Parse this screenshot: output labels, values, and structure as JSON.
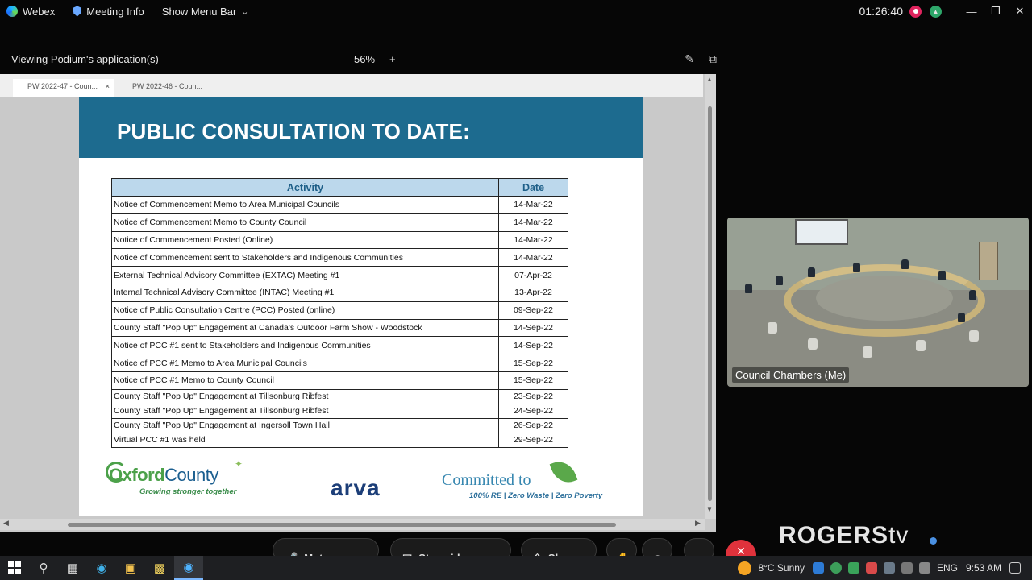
{
  "titlebar": {
    "app_name": "Webex",
    "meeting_info": "Meeting Info",
    "show_menu_bar": "Show Menu Bar",
    "timer": "01:26:40"
  },
  "share": {
    "viewing_label": "Viewing Podium's application(s)",
    "zoom_level": "56%"
  },
  "browser": {
    "tabs": [
      "PW 2022-47 - Coun...",
      "PW 2022-46 - Coun..."
    ]
  },
  "slide": {
    "title": "PUBLIC CONSULTATION TO DATE:",
    "table": {
      "headers": [
        "Activity",
        "Date"
      ],
      "rows": [
        [
          "Notice of Commencement Memo to Area Municipal Councils",
          "14-Mar-22"
        ],
        [
          "Notice of Commencement Memo to County Council",
          "14-Mar-22"
        ],
        [
          "Notice of Commencement Posted (Online)",
          "14-Mar-22"
        ],
        [
          "Notice of Commencement sent to Stakeholders and Indigenous Communities",
          "14-Mar-22"
        ],
        [
          "External Technical Advisory Committee (EXTAC) Meeting #1",
          "07-Apr-22"
        ],
        [
          "Internal Technical Advisory Committee (INTAC) Meeting #1",
          "13-Apr-22"
        ],
        [
          "Notice of Public Consultation Centre (PCC) Posted (online)",
          "09-Sep-22"
        ],
        [
          "County Staff \"Pop Up\" Engagement at Canada's Outdoor Farm Show - Woodstock",
          "14-Sep-22"
        ],
        [
          "Notice of PCC #1 sent to Stakeholders and Indigenous Communities",
          "14-Sep-22"
        ],
        [
          "Notice of PCC #1 Memo to Area Municipal Councils",
          "15-Sep-22"
        ],
        [
          "Notice of PCC #1 Memo to County Council",
          "15-Sep-22"
        ],
        [
          "County Staff \"Pop Up\" Engagement at Tillsonburg Ribfest",
          "23-Sep-22"
        ],
        [
          "County Staff \"Pop Up\" Engagement at Tillsonburg Ribfest",
          "24-Sep-22"
        ],
        [
          "County Staff \"Pop Up\" Engagement at Ingersoll Town Hall",
          "26-Sep-22"
        ],
        [
          "Virtual PCC #1 was held",
          "29-Sep-22"
        ]
      ]
    },
    "logos": {
      "oxford_name_a": "Oxford",
      "oxford_name_b": "County",
      "oxford_tagline": "Growing stronger together",
      "arva": "arva",
      "committed": "Committed to",
      "committed_tagline": "100% RE | Zero Waste | Zero Poverty"
    }
  },
  "video": {
    "label": "Council Chambers (Me)"
  },
  "controls": {
    "mute": "Mute",
    "stop_video": "Stop video",
    "share": "Share"
  },
  "overlay": {
    "rogers": "ROGERS",
    "tv": "tv"
  },
  "taskbar": {
    "weather": "8°C  Sunny",
    "language": "ENG",
    "clock": "9:53 AM"
  }
}
